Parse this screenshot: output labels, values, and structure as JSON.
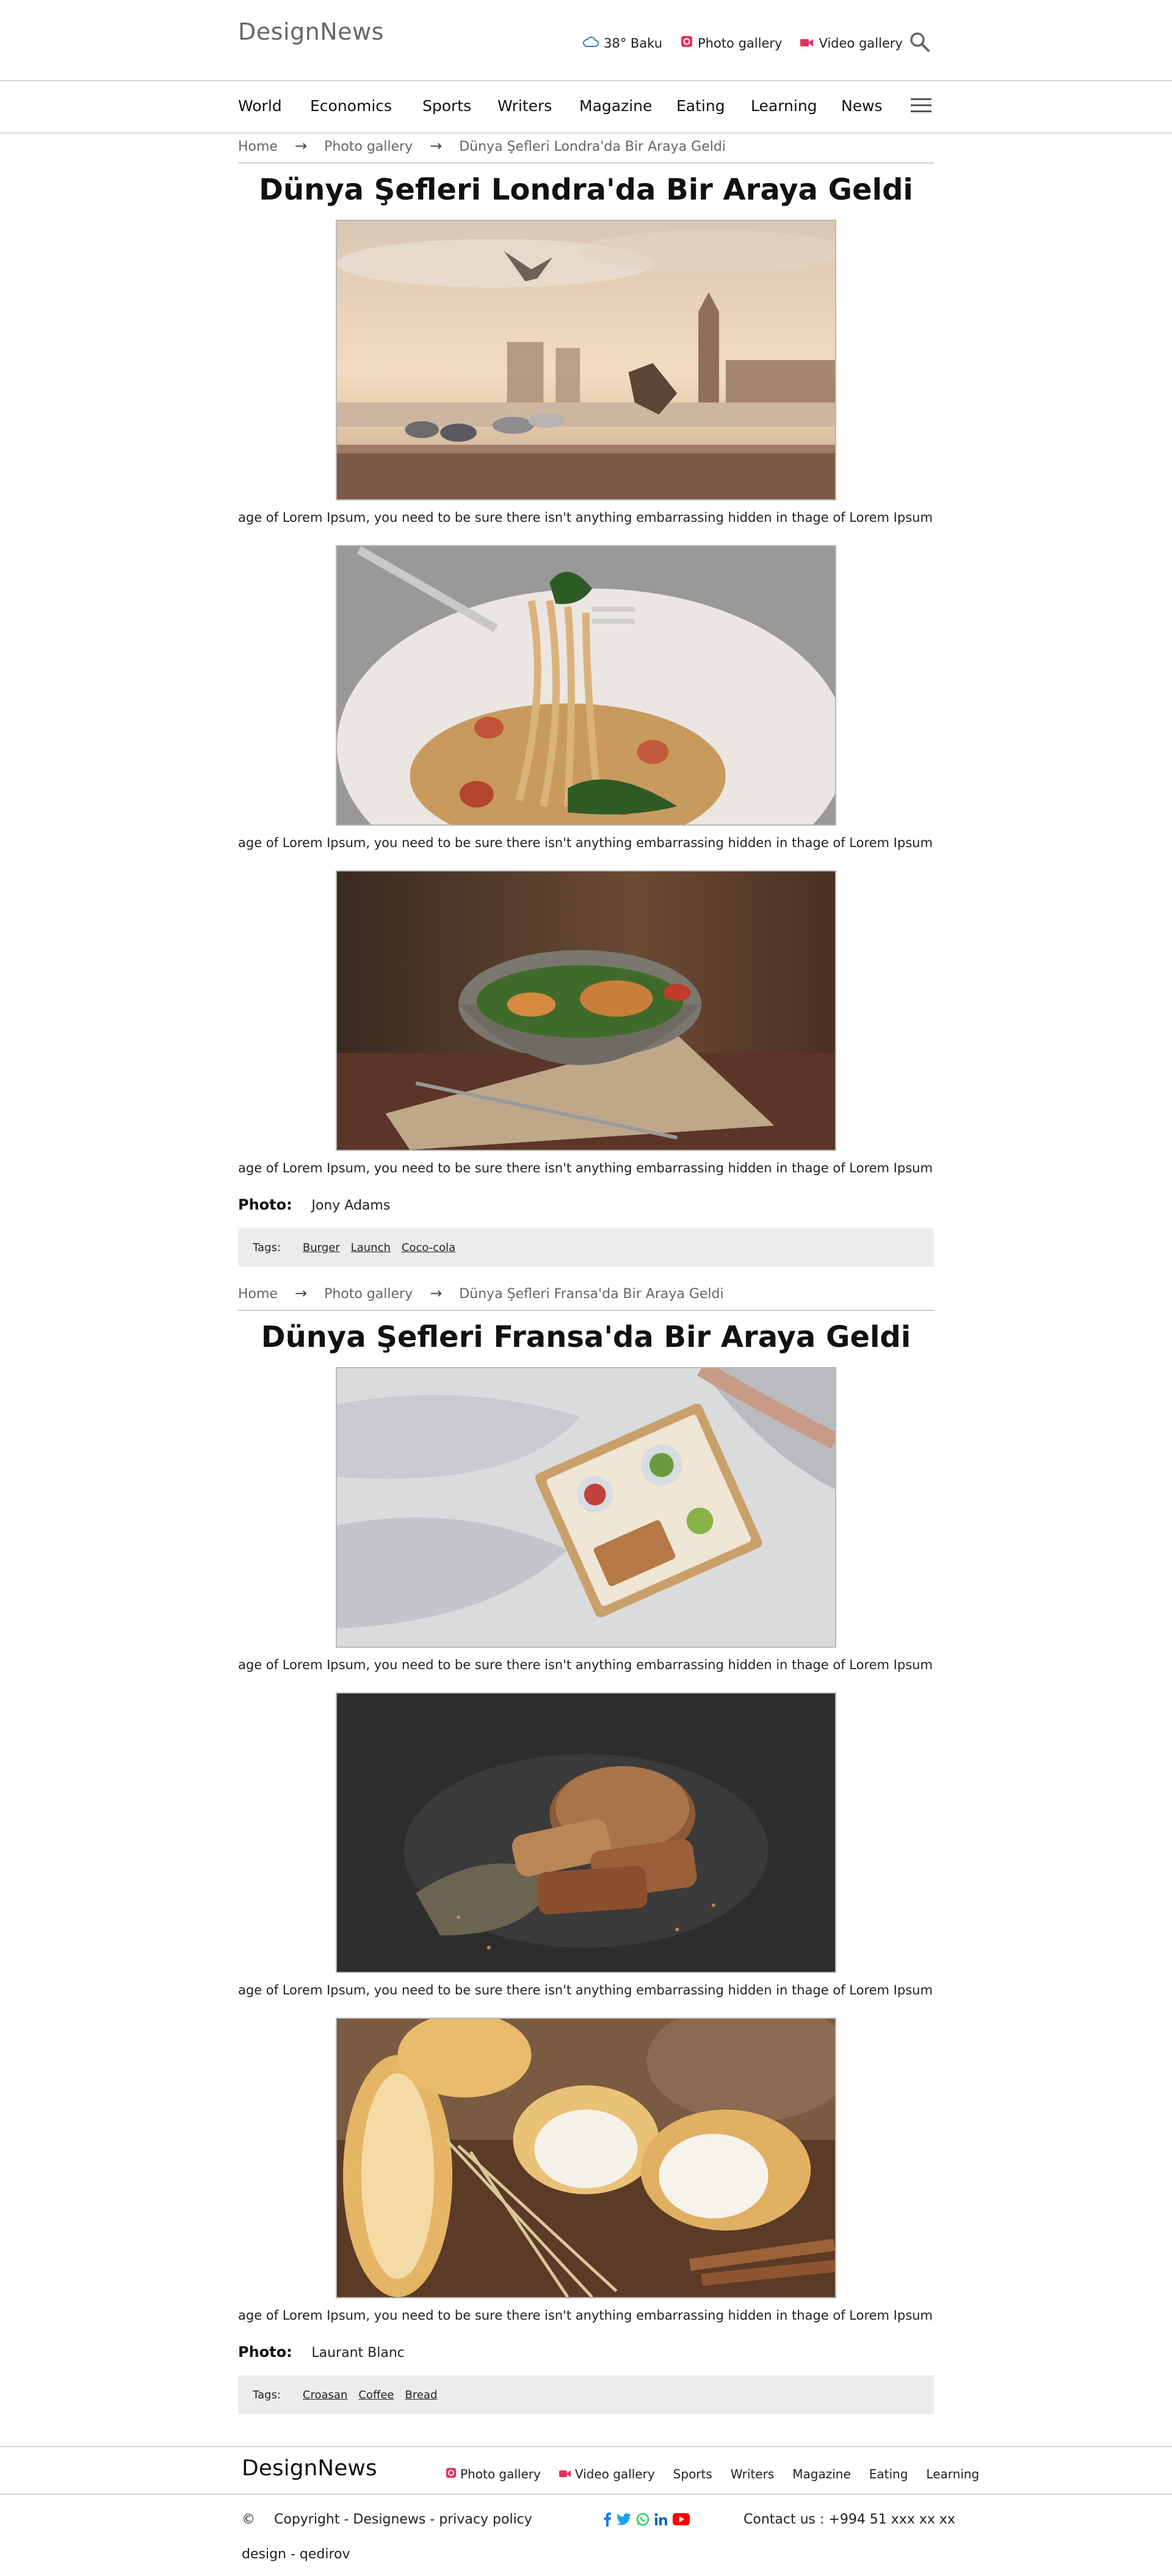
{
  "header": {
    "logo": "DesignNews",
    "weather": "38° Baku",
    "photo_gallery": "Photo gallery",
    "video_gallery": "Video gallery",
    "accent_color": "#e8315b",
    "weather_icon_color": "#2e7bd6"
  },
  "nav": [
    "World",
    "Economics",
    "Sports",
    "Writers",
    "Magazine",
    "Eating",
    "Learning",
    "News"
  ],
  "articles": [
    {
      "breadcrumb": [
        "Home",
        "Photo gallery",
        "Dünya Şefleri Londra'da Bir Araya Geldi"
      ],
      "title": "Dünya Şefleri Londra'da Bir Araya Geldi",
      "captions": [
        "age of Lorem Ipsum, you need to be sure there isn't anything embarrassing hidden in thage of Lorem Ipsum, you",
        "age of Lorem Ipsum, you need to be sure there isn't anything embarrassing hidden in thage of Lorem Ipsum, you",
        "age of Lorem Ipsum, you need to be sure there isn't anything embarrassing hidden in thage of Lorem Ipsum, you"
      ],
      "photo_label": "Photo:",
      "photo_author": "Jony Adams",
      "tags_label": "Tags:",
      "tags": [
        "Burger",
        "Launch",
        "Coco-cola"
      ]
    },
    {
      "breadcrumb": [
        "Home",
        "Photo gallery",
        "Dünya Şefleri Fransa'da Bir Araya Geldi"
      ],
      "title": "Dünya Şefleri Fransa'da Bir Araya Geldi",
      "captions": [
        "age of Lorem Ipsum, you need to be sure there isn't anything embarrassing hidden in thage of Lorem Ipsum, you",
        "age of Lorem Ipsum, you need to be sure there isn't anything embarrassing hidden in thage of Lorem Ipsum, you",
        "age of Lorem Ipsum, you need to be sure there isn't anything embarrassing hidden in thage of Lorem Ipsum, you"
      ],
      "photo_label": "Photo:",
      "photo_author": "Laurant Blanc",
      "tags_label": "Tags:",
      "tags": [
        "Croasan",
        "Coffee",
        "Bread"
      ]
    }
  ],
  "footer": {
    "logo": "DesignNews",
    "links": [
      "Photo gallery",
      "Video gallery",
      "Sports",
      "Writers",
      "Magazine",
      "Eating",
      "Learning"
    ],
    "copyright_symbol": "©",
    "copyright": "Copyright - Designews - privacy policy",
    "contact": "Contact us : +994 51 xxx xx xx",
    "design": "design - qedirov",
    "social_icons": [
      "facebook-icon",
      "twitter-icon",
      "whatsapp-icon",
      "linkedin-icon",
      "youtube-icon"
    ]
  }
}
